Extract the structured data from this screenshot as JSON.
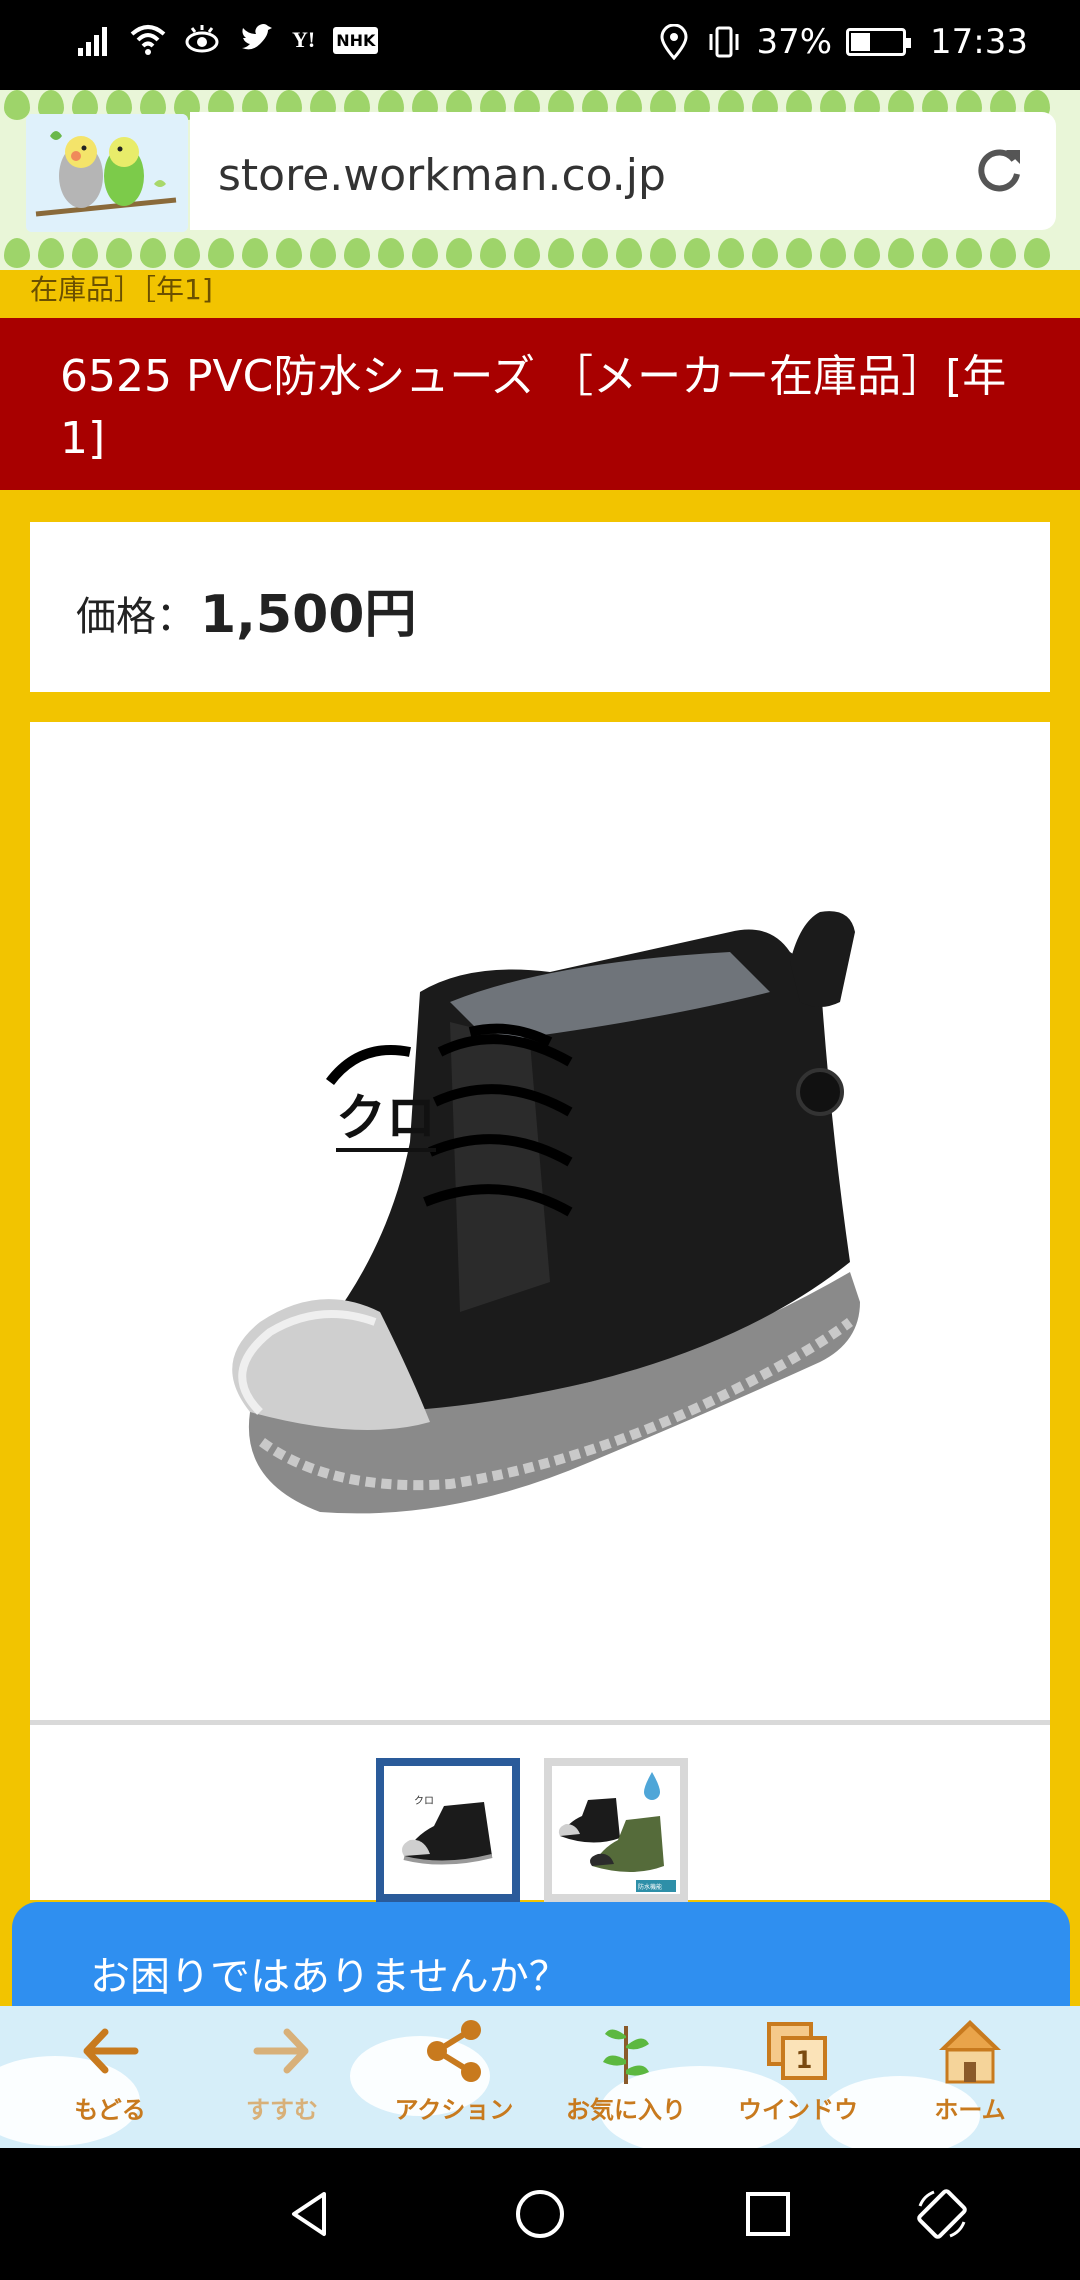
{
  "status_bar": {
    "left_icons": [
      "signal-icon",
      "wifi-icon",
      "eye-icon",
      "twitter-icon",
      "yahoo-icon",
      "nhk-icon"
    ],
    "yahoo_text": "Y!",
    "nhk_text": "NHK",
    "right_icons": [
      "location-icon",
      "vibrate-icon",
      "battery-icon"
    ],
    "battery_percent": "37%",
    "battery_level": 0.37,
    "time": "17:33"
  },
  "browser": {
    "url": "store.workman.co.jp"
  },
  "breadcrumb": {
    "text": "在庫品］［年1]"
  },
  "product": {
    "title": "6525 PVC防水シューズ ［メーカー在庫品］[年1]",
    "price_label": "価格：",
    "price_value": "1,500円",
    "color_label": "クロ",
    "thumb2_badge": "防水機能",
    "thumb1_text": "クロ"
  },
  "chat": {
    "prompt": "お困りではありませんか？"
  },
  "toolbar": {
    "items": [
      {
        "label": "もどる",
        "icon": "back-arrow-icon"
      },
      {
        "label": "すすむ",
        "icon": "forward-arrow-icon"
      },
      {
        "label": "アクション",
        "icon": "share-icon"
      },
      {
        "label": "お気に入り",
        "icon": "plant-icon"
      },
      {
        "label": "ウインドウ",
        "icon": "windows-icon"
      },
      {
        "label": "ホーム",
        "icon": "house-icon"
      }
    ],
    "window_count": "1"
  },
  "colors": {
    "page_bg": "#f2c400",
    "title_band": "#a80000",
    "chat_banner": "#2f8ff0",
    "toolbar_label": "#c87a1e"
  }
}
